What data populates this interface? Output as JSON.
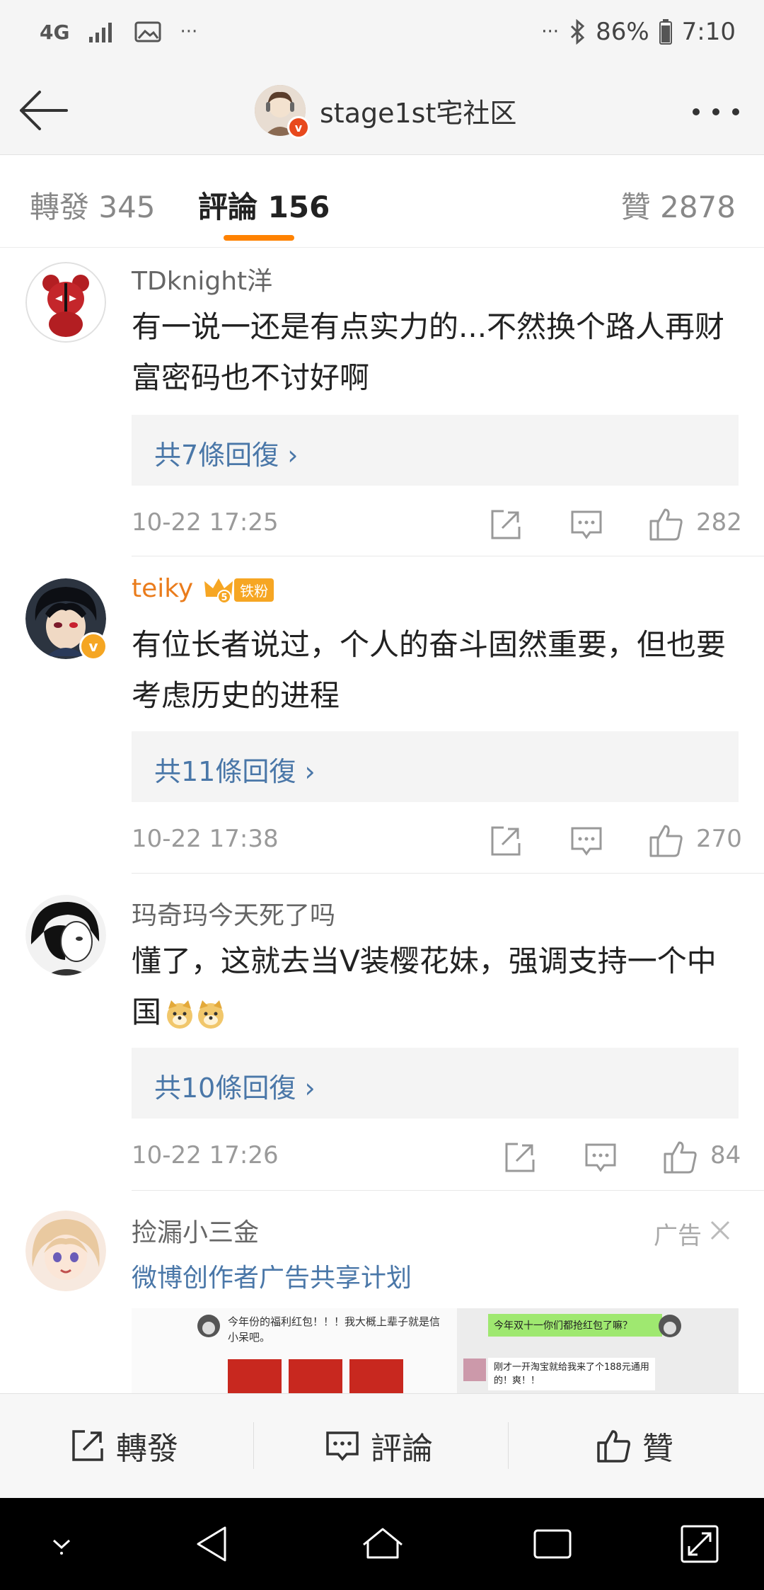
{
  "status_bar": {
    "network": "4G",
    "battery": "86%",
    "time": "7:10",
    "more_left": "···",
    "more_right": "···"
  },
  "header": {
    "title": "stage1st宅社区"
  },
  "tabs": [
    {
      "label": "轉發 345"
    },
    {
      "label": "評論 156"
    },
    {
      "label": "贊 2878"
    }
  ],
  "comments": [
    {
      "user": "TDknight洋",
      "text": "有一说一还是有点实力的...不然换个路人再财富密码也不讨好啊",
      "replies": "共7條回復",
      "time": "10-22 17:25",
      "likes": "282"
    },
    {
      "user": "teiky",
      "fan_level": "5",
      "fan_badge": "铁粉",
      "text": "有位长者说过，个人的奋斗固然重要，但也要考虑历史的进程",
      "replies": "共11條回復",
      "time": "10-22 17:38",
      "likes": "270"
    },
    {
      "user": "玛奇玛今天死了吗",
      "text": "懂了，这就去当V装樱花妹，强调支持一个中国",
      "replies": "共10條回復",
      "time": "10-22 17:26",
      "likes": "84"
    }
  ],
  "ad": {
    "user": "捡漏小三金",
    "tag": "广告",
    "subtitle": "微博创作者广告共享计划",
    "preview": {
      "left_text": "今年份的福利红包！！！我大概上辈子就是信小呆吧。",
      "right_bubble": "今年双十一你们都抢红包了嘛？",
      "right_text": "刚才一开淘宝就给我来了个188元通用的！爽！！"
    }
  },
  "bottom_bar": {
    "repost": "轉發",
    "comment": "評論",
    "like": "贊"
  },
  "colors": {
    "accent": "#ff8200",
    "link": "#4a77a8",
    "vip_name": "#ea7c1c"
  }
}
